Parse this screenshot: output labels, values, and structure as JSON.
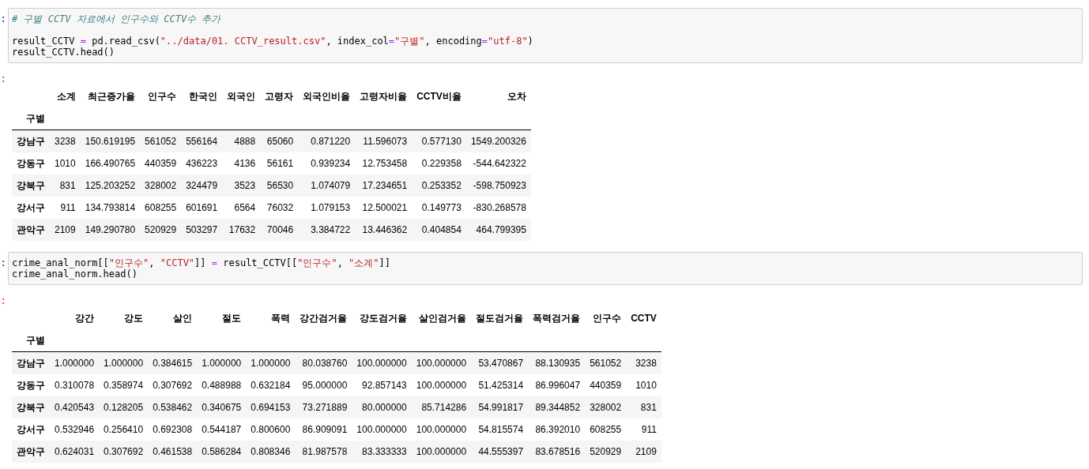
{
  "cells": [
    {
      "kind": "code",
      "prompt": ":",
      "lines": [
        {
          "tokens": [
            {
              "kind": "comment",
              "text": "# 구별 CCTV 자료에서 인구수와 CCTV수 추가"
            }
          ]
        },
        {
          "gap_before": true,
          "tokens": [
            {
              "kind": "plain",
              "text": "result_CCTV "
            },
            {
              "kind": "operator",
              "text": "="
            },
            {
              "kind": "plain",
              "text": " pd.read_csv("
            },
            {
              "kind": "string",
              "text": "\"../data/01. CCTV_result.csv\""
            },
            {
              "kind": "plain",
              "text": ", index_col"
            },
            {
              "kind": "operator",
              "text": "="
            },
            {
              "kind": "string",
              "text": "\"구별\""
            },
            {
              "kind": "plain",
              "text": ", encoding"
            },
            {
              "kind": "operator",
              "text": "="
            },
            {
              "kind": "string",
              "text": "\"utf-8\""
            },
            {
              "kind": "plain",
              "text": ")"
            }
          ]
        },
        {
          "tokens": [
            {
              "kind": "plain",
              "text": "result_CCTV.head()"
            }
          ]
        }
      ]
    },
    {
      "kind": "table",
      "prompt": ":",
      "index_name": "구별",
      "columns": [
        "소계",
        "최근증가율",
        "인구수",
        "한국인",
        "외국인",
        "고령자",
        "외국인비율",
        "고령자비율",
        "CCTV비율",
        "오차"
      ],
      "rows": [
        {
          "index": "강남구",
          "cells": [
            "3238",
            "150.619195",
            "561052",
            "556164",
            "4888",
            "65060",
            "0.871220",
            "11.596073",
            "0.577130",
            "1549.200326"
          ]
        },
        {
          "index": "강동구",
          "cells": [
            "1010",
            "166.490765",
            "440359",
            "436223",
            "4136",
            "56161",
            "0.939234",
            "12.753458",
            "0.229358",
            "-544.642322"
          ]
        },
        {
          "index": "강북구",
          "cells": [
            "831",
            "125.203252",
            "328002",
            "324479",
            "3523",
            "56530",
            "1.074079",
            "17.234651",
            "0.253352",
            "-598.750923"
          ]
        },
        {
          "index": "강서구",
          "cells": [
            "911",
            "134.793814",
            "608255",
            "601691",
            "6564",
            "76032",
            "1.079153",
            "12.500021",
            "0.149773",
            "-830.268578"
          ]
        },
        {
          "index": "관악구",
          "cells": [
            "2109",
            "149.290780",
            "520929",
            "503297",
            "17632",
            "70046",
            "3.384722",
            "13.446362",
            "0.404854",
            "464.799395"
          ]
        }
      ]
    },
    {
      "kind": "code",
      "prompt": ":",
      "lines": [
        {
          "tokens": [
            {
              "kind": "plain",
              "text": "crime_anal_norm[["
            },
            {
              "kind": "string",
              "text": "\"인구수\""
            },
            {
              "kind": "plain",
              "text": ", "
            },
            {
              "kind": "string",
              "text": "\"CCTV\""
            },
            {
              "kind": "plain",
              "text": "]] "
            },
            {
              "kind": "operator",
              "text": "="
            },
            {
              "kind": "plain",
              "text": " result_CCTV[["
            },
            {
              "kind": "string",
              "text": "\"인구수\""
            },
            {
              "kind": "plain",
              "text": ", "
            },
            {
              "kind": "string",
              "text": "\"소계\""
            },
            {
              "kind": "plain",
              "text": "]]"
            }
          ]
        },
        {
          "tokens": [
            {
              "kind": "plain",
              "text": "crime_anal_norm.head()"
            }
          ]
        }
      ]
    },
    {
      "kind": "table",
      "prompt": ":",
      "index_name": "구별",
      "columns": [
        "강간",
        "강도",
        "살인",
        "절도",
        "폭력",
        "강간검거율",
        "강도검거율",
        "살인검거율",
        "절도검거율",
        "폭력검거율",
        "인구수",
        "CCTV"
      ],
      "rows": [
        {
          "index": "강남구",
          "cells": [
            "1.000000",
            "1.000000",
            "0.384615",
            "1.000000",
            "1.000000",
            "80.038760",
            "100.000000",
            "100.000000",
            "53.470867",
            "88.130935",
            "561052",
            "3238"
          ]
        },
        {
          "index": "강동구",
          "cells": [
            "0.310078",
            "0.358974",
            "0.307692",
            "0.488988",
            "0.632184",
            "95.000000",
            "92.857143",
            "100.000000",
            "51.425314",
            "86.996047",
            "440359",
            "1010"
          ]
        },
        {
          "index": "강북구",
          "cells": [
            "0.420543",
            "0.128205",
            "0.538462",
            "0.340675",
            "0.694153",
            "73.271889",
            "80.000000",
            "85.714286",
            "54.991817",
            "89.344852",
            "328002",
            "831"
          ]
        },
        {
          "index": "강서구",
          "cells": [
            "0.532946",
            "0.256410",
            "0.692308",
            "0.544187",
            "0.800600",
            "86.909091",
            "100.000000",
            "100.000000",
            "54.815574",
            "86.392010",
            "608255",
            "911"
          ]
        },
        {
          "index": "관악구",
          "cells": [
            "0.624031",
            "0.307692",
            "0.461538",
            "0.586284",
            "0.808346",
            "81.987578",
            "83.333333",
            "100.000000",
            "44.555397",
            "83.678516",
            "520929",
            "2109"
          ]
        }
      ]
    }
  ]
}
